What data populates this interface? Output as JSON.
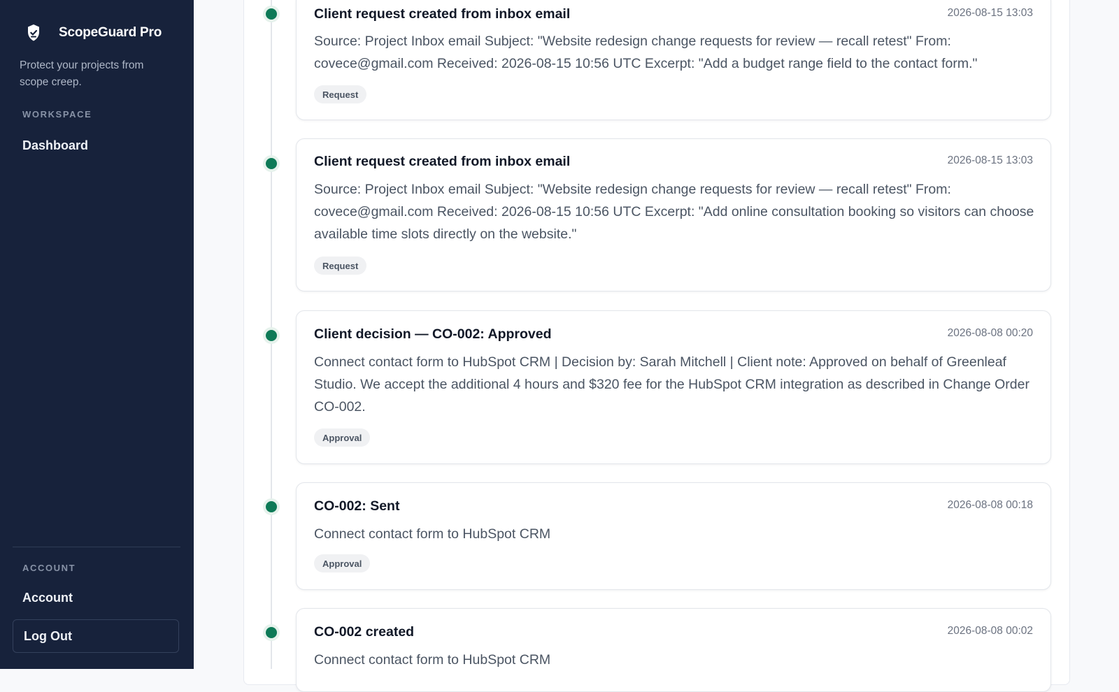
{
  "sidebar": {
    "brand": "ScopeGuard Pro",
    "tagline": "Protect your projects from scope creep.",
    "workspace_label": "WORKSPACE",
    "dashboard": "Dashboard",
    "account_label": "ACCOUNT",
    "account": "Account",
    "logout": "Log Out",
    "brand_icon": "shield-check-icon"
  },
  "accent_color": "#0e7a57",
  "events": [
    {
      "title": "Client request created from inbox email",
      "time": "2026-08-15 13:03",
      "body": "Source: Project Inbox email Subject: \"Website redesign change requests for review — recall retest\" From: covece@gmail.com Received: 2026-08-15 10:56 UTC Excerpt: \"Add a budget range field to the contact form.\"",
      "tag": "Request"
    },
    {
      "title": "Client request created from inbox email",
      "time": "2026-08-15 13:03",
      "body": "Source: Project Inbox email Subject: \"Website redesign change requests for review — recall retest\" From: covece@gmail.com Received: 2026-08-15 10:56 UTC Excerpt: \"Add online consultation booking so visitors can choose available time slots directly on the website.\"",
      "tag": "Request"
    },
    {
      "title": "Client decision — CO-002: Approved",
      "time": "2026-08-08 00:20",
      "body": "Connect contact form to HubSpot CRM | Decision by: Sarah Mitchell | Client note: Approved on behalf of Greenleaf Studio. We accept the additional 4 hours and $320 fee for the HubSpot CRM integration as described in Change Order CO-002.",
      "tag": "Approval"
    },
    {
      "title": "CO-002: Sent",
      "time": "2026-08-08 00:18",
      "body": "Connect contact form to HubSpot CRM",
      "tag": "Approval"
    },
    {
      "title": "CO-002 created",
      "time": "2026-08-08 00:02",
      "body": "Connect contact form to HubSpot CRM",
      "tag": ""
    }
  ]
}
